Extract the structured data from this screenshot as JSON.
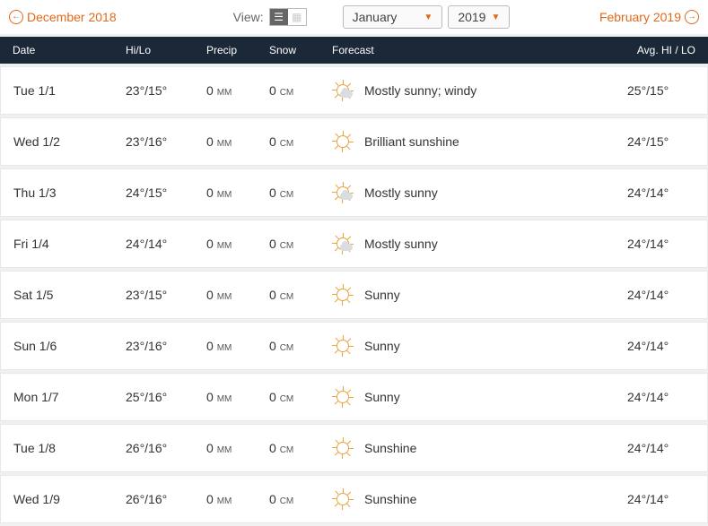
{
  "nav": {
    "prev_label": "December 2018",
    "next_label": "February 2019",
    "view_label": "View:"
  },
  "selects": {
    "month": "January",
    "year": "2019"
  },
  "headers": {
    "date": "Date",
    "hilo": "Hi/Lo",
    "precip": "Precip",
    "snow": "Snow",
    "forecast": "Forecast",
    "avg": "Avg. HI / LO"
  },
  "units": {
    "precip": "MM",
    "snow": "CM"
  },
  "rows": [
    {
      "date": "Tue 1/1",
      "hilo": "23°/15°",
      "precip": "0",
      "snow": "0",
      "icon": "mostly-sunny",
      "forecast": "Mostly sunny; windy",
      "avg": "25°/15°"
    },
    {
      "date": "Wed 1/2",
      "hilo": "23°/16°",
      "precip": "0",
      "snow": "0",
      "icon": "sunny",
      "forecast": "Brilliant sunshine",
      "avg": "24°/15°"
    },
    {
      "date": "Thu 1/3",
      "hilo": "24°/15°",
      "precip": "0",
      "snow": "0",
      "icon": "mostly-sunny",
      "forecast": "Mostly sunny",
      "avg": "24°/14°"
    },
    {
      "date": "Fri 1/4",
      "hilo": "24°/14°",
      "precip": "0",
      "snow": "0",
      "icon": "mostly-sunny",
      "forecast": "Mostly sunny",
      "avg": "24°/14°"
    },
    {
      "date": "Sat 1/5",
      "hilo": "23°/15°",
      "precip": "0",
      "snow": "0",
      "icon": "sunny",
      "forecast": "Sunny",
      "avg": "24°/14°"
    },
    {
      "date": "Sun 1/6",
      "hilo": "23°/16°",
      "precip": "0",
      "snow": "0",
      "icon": "sunny",
      "forecast": "Sunny",
      "avg": "24°/14°"
    },
    {
      "date": "Mon 1/7",
      "hilo": "25°/16°",
      "precip": "0",
      "snow": "0",
      "icon": "sunny",
      "forecast": "Sunny",
      "avg": "24°/14°"
    },
    {
      "date": "Tue 1/8",
      "hilo": "26°/16°",
      "precip": "0",
      "snow": "0",
      "icon": "sunny",
      "forecast": "Sunshine",
      "avg": "24°/14°"
    },
    {
      "date": "Wed 1/9",
      "hilo": "26°/16°",
      "precip": "0",
      "snow": "0",
      "icon": "sunny",
      "forecast": "Sunshine",
      "avg": "24°/14°"
    }
  ]
}
